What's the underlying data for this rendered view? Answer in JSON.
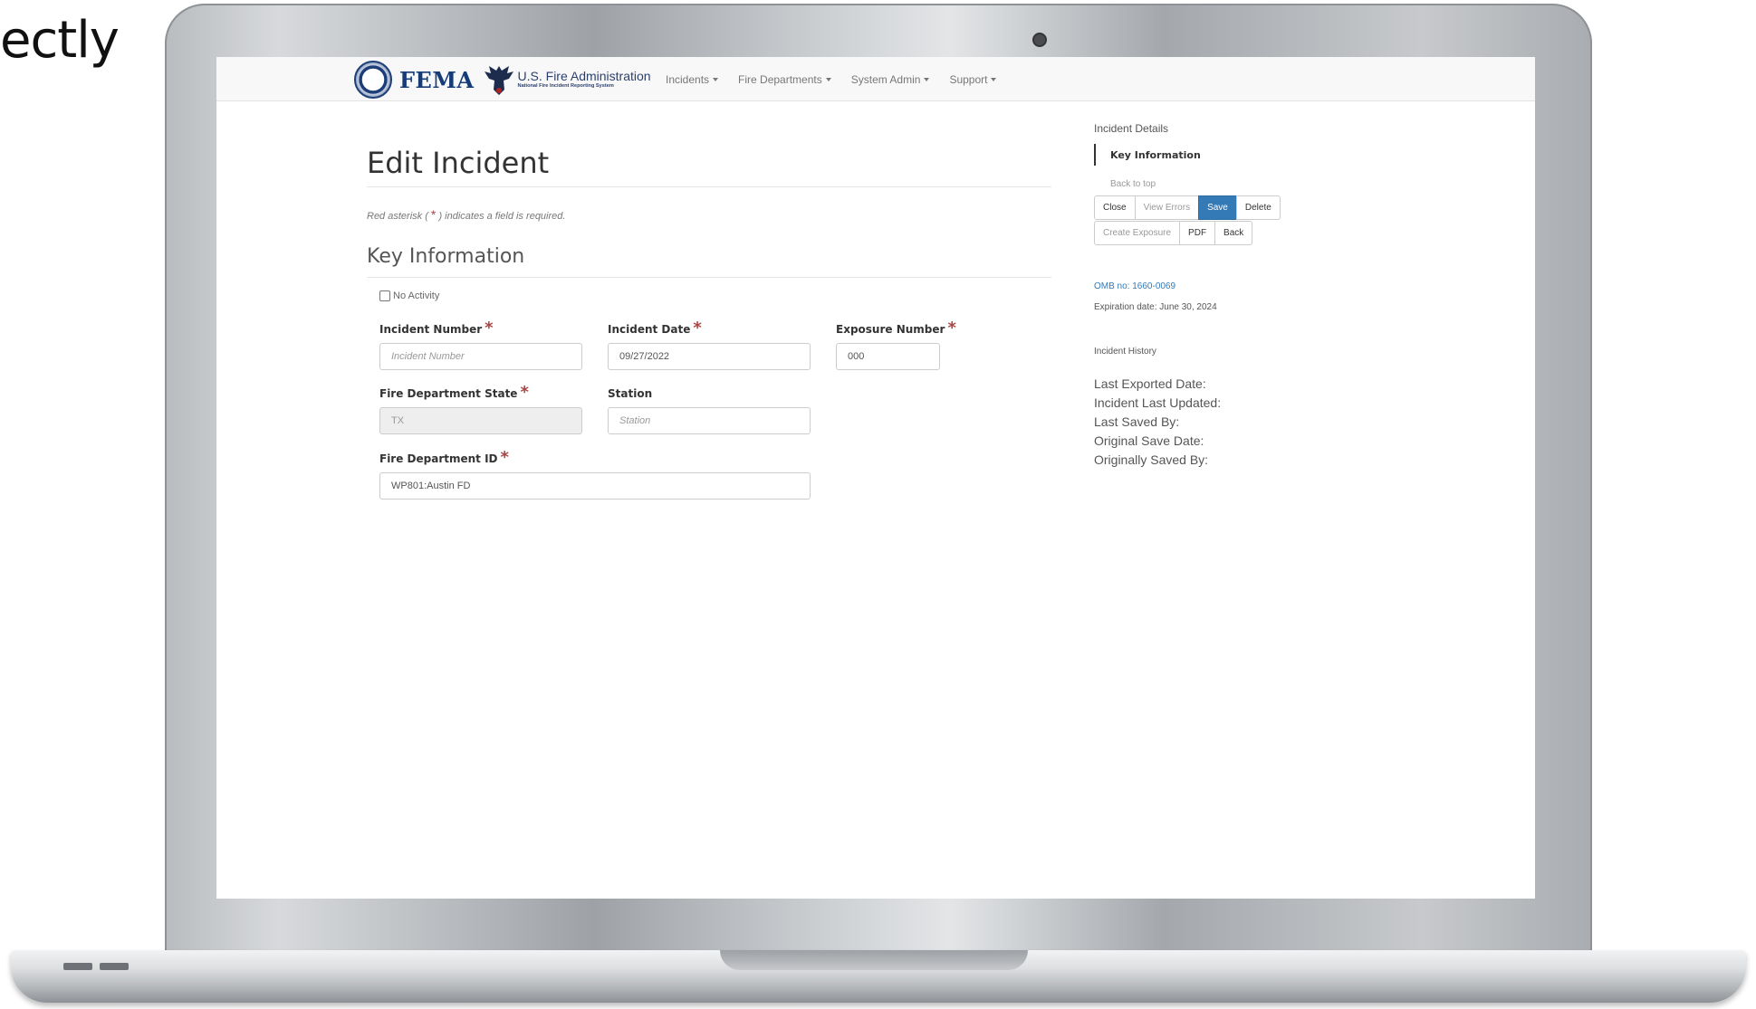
{
  "slide_text": "ectly",
  "nav": {
    "brand": "FEMA",
    "usfa_title": "U.S. Fire Administration",
    "usfa_subtitle": "National Fire Incident Reporting System",
    "menu": [
      {
        "label": "Incidents"
      },
      {
        "label": "Fire Departments"
      },
      {
        "label": "System Admin"
      },
      {
        "label": "Support"
      }
    ]
  },
  "form": {
    "title": "Edit Incident",
    "required_note_prefix": "Red asterisk (",
    "required_note_star": "*",
    "required_note_suffix": ") indicates a field is required.",
    "section": "Key Information",
    "no_activity_label": "No Activity",
    "fields": {
      "incident_number": {
        "label": "Incident Number",
        "placeholder": "Incident Number"
      },
      "incident_date": {
        "label": "Incident Date",
        "value": "09/27/2022"
      },
      "exposure_number": {
        "label": "Exposure Number",
        "value": "000"
      },
      "fd_state": {
        "label": "Fire Department State",
        "value": "TX"
      },
      "station": {
        "label": "Station",
        "placeholder": "Station"
      },
      "fd_id": {
        "label": "Fire Department ID",
        "value": "WP801:Austin FD"
      }
    },
    "required_mark": "*"
  },
  "sidebar": {
    "title": "Incident Details",
    "active_link": "Key Information",
    "back_to_top": "Back to top",
    "buttons_row1": [
      "Close",
      "View Errors",
      "Save",
      "Delete"
    ],
    "buttons_row2": [
      "Create Exposure",
      "PDF",
      "Back"
    ],
    "omb": "OMB no: 1660-0069",
    "expiration": "Expiration date: June 30, 2024",
    "history_title": "Incident History",
    "history": [
      "Last Exported Date:",
      "Incident Last Updated:",
      "Last Saved By:",
      "Original Save Date:",
      "Originally Saved By:"
    ]
  },
  "colors": {
    "primary": "#337ab7",
    "required": "#a94442",
    "brand": "#163c78"
  }
}
